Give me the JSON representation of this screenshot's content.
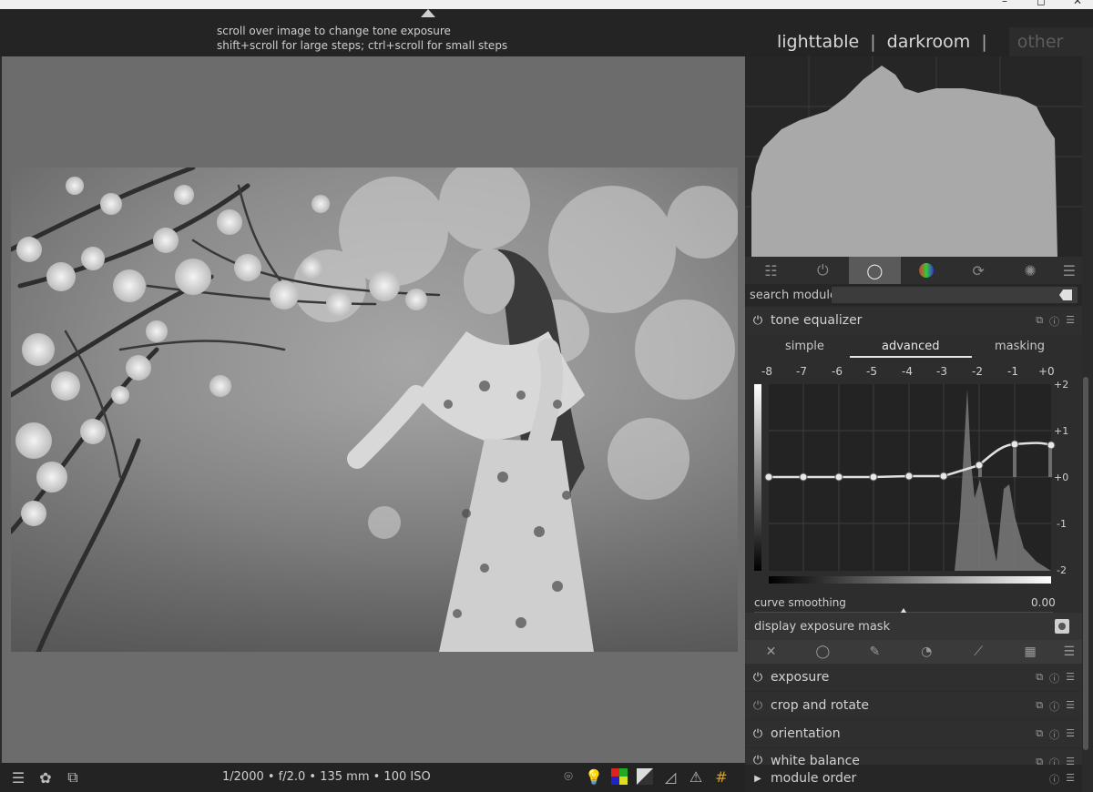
{
  "topbar": {
    "hint_line1": "scroll over image to change tone exposure",
    "hint_line2": "shift+scroll for large steps; ctrl+scroll for small steps",
    "views": [
      "lighttable",
      "darkroom"
    ],
    "separator": "|",
    "other_label": "other"
  },
  "icons": {
    "collapse_top": "collapse-up-icon",
    "tab_quick": "sliders-icon",
    "tab_active": "power-icon",
    "tab_base": "circle-icon",
    "tab_color": "color-wheel-icon",
    "tab_correct": "loop-icon",
    "tab_effect": "aperture-icon",
    "tab_menu": "hamburger-icon"
  },
  "right_panel": {
    "search_label": "search module",
    "search_value": "",
    "tone_equalizer": {
      "title": "tone equalizer",
      "subtabs": [
        "simple",
        "advanced",
        "masking"
      ],
      "active_subtab": "advanced",
      "ev_labels": [
        "-8",
        "-7",
        "-6",
        "-5",
        "-4",
        "-3",
        "-2",
        "-1",
        "+0"
      ],
      "y_labels": [
        "+2",
        "+1",
        "+0",
        "-1",
        "-2"
      ],
      "curve_smoothing_label": "curve smoothing",
      "curve_smoothing_value": "0.00",
      "display_mask_label": "display exposure mask"
    },
    "modules": [
      {
        "name": "exposure",
        "enabled": true
      },
      {
        "name": "crop and rotate",
        "enabled": false
      },
      {
        "name": "orientation",
        "enabled": true
      },
      {
        "name": "white balance",
        "enabled": true
      }
    ],
    "module_order_label": "module order"
  },
  "bottombar": {
    "exif": "1/2000 • f/2.0 • 135 mm • 100 ISO"
  },
  "colors": {
    "accent_active_tab": "#5a5a5a",
    "background": "#2b2b2b",
    "center_bg": "#6c6c6c"
  }
}
